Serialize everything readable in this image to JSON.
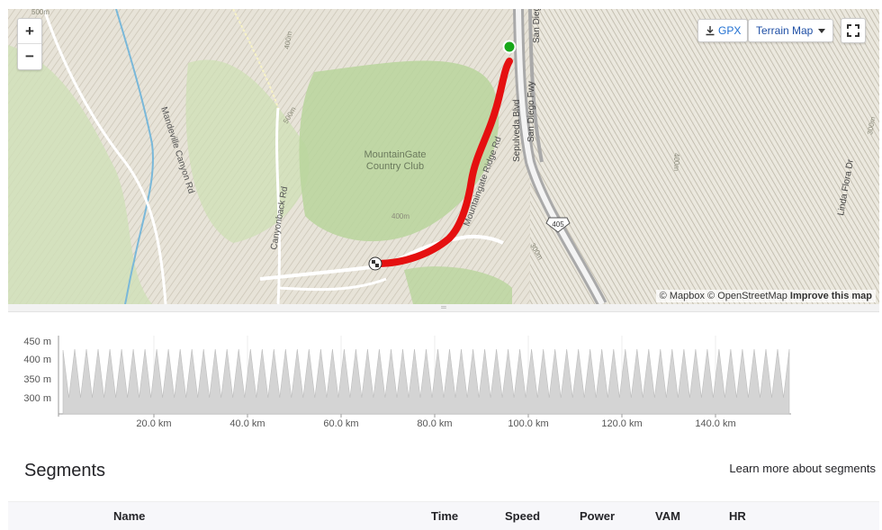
{
  "map": {
    "zoom_in": "+",
    "zoom_out": "−",
    "gpx_label": "GPX",
    "map_type": "Terrain Map",
    "attribution": {
      "mapbox": "© Mapbox",
      "osm": "© OpenStreetMap",
      "improve": "Improve this map"
    },
    "labels": {
      "place": [
        "MountainGate",
        "Country Club"
      ],
      "roads": [
        "Mandeville Canyon Rd",
        "Canyonback Rd",
        "Mountaingate Ridge Rd",
        "Sepulveda Blvd",
        "San Diego Fwy",
        "San Dieg",
        "Linda Flora Dr"
      ],
      "highway_shield": "405",
      "contours": [
        "500m",
        "400m",
        "500m",
        "400m",
        "300m",
        "400m",
        "300m"
      ]
    },
    "colors": {
      "route": "#e51010",
      "start": "#17a81a",
      "water": "#7ab8d9",
      "park": "#b7d49a"
    }
  },
  "elevation": {
    "y_ticks": [
      "450 m",
      "400 m",
      "350 m",
      "300 m"
    ],
    "x_ticks": [
      "20.0 km",
      "40.0 km",
      "60.0 km",
      "80.0 km",
      "100.0 km",
      "120.0 km",
      "140.0 km"
    ]
  },
  "segments": {
    "title": "Segments",
    "learn_more": "Learn more about segments",
    "columns": [
      "Name",
      "Time",
      "Speed",
      "Power",
      "VAM",
      "HR"
    ]
  }
}
